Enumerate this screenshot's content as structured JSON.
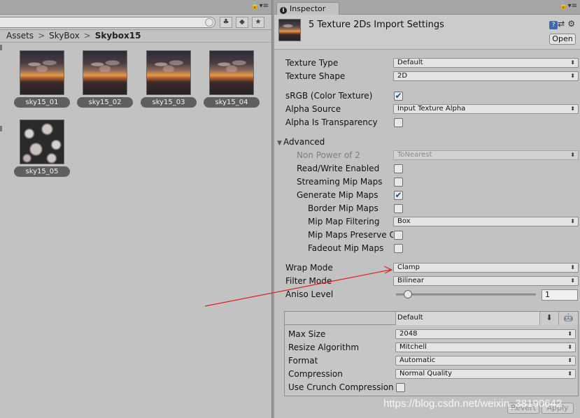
{
  "left_panel": {
    "menu_icon": "lock-and-menu-icon",
    "menu_glyph": "🔒▾≡",
    "toolbar": {
      "btn1": "♣",
      "btn2": "◆",
      "btn3": "★"
    },
    "breadcrumb": {
      "items": [
        "Assets",
        "SkyBox"
      ],
      "current": "Skybox15",
      "separator": ">"
    },
    "assets": [
      {
        "label": "sky15_01",
        "kind": "sunset"
      },
      {
        "label": "sky15_02",
        "kind": "sunset"
      },
      {
        "label": "sky15_03",
        "kind": "sunset"
      },
      {
        "label": "sky15_04",
        "kind": "sunset"
      },
      {
        "label": "sky15_05",
        "kind": "clouds"
      }
    ]
  },
  "inspector": {
    "tab_label": "Inspector",
    "menu_glyph": "🔒▾≡",
    "header": {
      "title": "5 Texture 2Ds Import Settings",
      "open_button": "Open",
      "help_glyph": "?",
      "preset_glyph": "⇄",
      "settings_glyph": "⚙"
    },
    "props": {
      "texture_type": {
        "label": "Texture Type",
        "value": "Default"
      },
      "texture_shape": {
        "label": "Texture Shape",
        "value": "2D"
      },
      "srgb": {
        "label": "sRGB (Color Texture)",
        "checked": true,
        "mark": "✔"
      },
      "alpha_source": {
        "label": "Alpha Source",
        "value": "Input Texture Alpha"
      },
      "alpha_transparency": {
        "label": "Alpha Is Transparency",
        "checked": false,
        "mark": ""
      },
      "advanced": {
        "label": "Advanced",
        "arrow": "▼"
      },
      "npot": {
        "label": "Non Power of 2",
        "value": "ToNearest"
      },
      "read_write": {
        "label": "Read/Write Enabled",
        "checked": false,
        "mark": ""
      },
      "streaming": {
        "label": "Streaming Mip Maps",
        "checked": false,
        "mark": ""
      },
      "gen_mips": {
        "label": "Generate Mip Maps",
        "checked": true,
        "mark": "✔"
      },
      "border_mips": {
        "label": "Border Mip Maps",
        "checked": false,
        "mark": ""
      },
      "mip_filter": {
        "label": "Mip Map Filtering",
        "value": "Box"
      },
      "mip_preserve": {
        "label": "Mip Maps Preserve Coverage",
        "checked": false,
        "mark": ""
      },
      "fadeout": {
        "label": "Fadeout Mip Maps",
        "checked": false,
        "mark": ""
      },
      "wrap_mode": {
        "label": "Wrap Mode",
        "value": "Clamp"
      },
      "filter_mode": {
        "label": "Filter Mode",
        "value": "Bilinear"
      },
      "aniso": {
        "label": "Aniso Level",
        "value": "1",
        "level_fraction": 0.06
      }
    },
    "platform": {
      "tab_default": "Default",
      "download_glyph": "⬇",
      "android_glyph": "🤖",
      "max_size": {
        "label": "Max Size",
        "value": "2048"
      },
      "resize": {
        "label": "Resize Algorithm",
        "value": "Mitchell"
      },
      "format": {
        "label": "Format",
        "value": "Automatic"
      },
      "compression": {
        "label": "Compression",
        "value": "Normal Quality"
      },
      "crunch": {
        "label": "Use Crunch Compression",
        "checked": false,
        "mark": ""
      }
    },
    "buttons": {
      "revert": "Revert",
      "apply": "Apply"
    },
    "dropdown_arrow": "⬍"
  },
  "watermark": "https://blog.csdn.net/weixin_38190642",
  "colors": {
    "annotation_arrow": "#e02020",
    "check_accent": "#2a4f86"
  }
}
